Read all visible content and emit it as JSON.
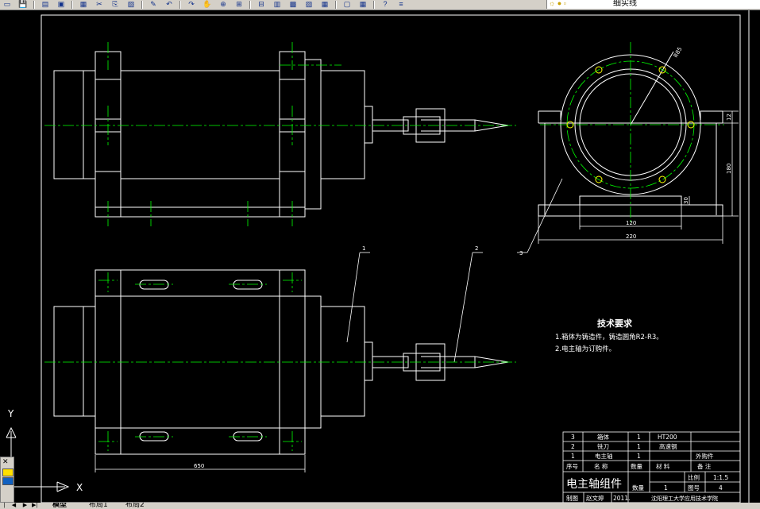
{
  "toolbar": {
    "icons": [
      "open-icon",
      "save-icon",
      "print-icon",
      "preview-icon",
      "publish-icon",
      "cut-icon",
      "copy-icon",
      "paste-icon",
      "match-properties-icon",
      "undo-icon",
      "redo-icon",
      "pan-icon",
      "zoom-realtime-icon",
      "zoom-window-icon",
      "zoom-previous-icon",
      "properties-icon",
      "design-center-icon",
      "tool-palettes-icon",
      "sheet-set-icon",
      "markup-icon",
      "calculator-icon",
      "help-icon",
      "layer-manager-icon"
    ],
    "layer_name": "细实线"
  },
  "drawing": {
    "balloons": [
      "1",
      "2",
      "3"
    ],
    "dimensions": {
      "overall_length": "650",
      "width_220": "220",
      "width_120": "120",
      "height_180": "180",
      "height_12": "12",
      "height_30": "30",
      "radius_label": "R85"
    },
    "tech_req": {
      "title": "技术要求",
      "line1": "1.箱体为铸造件，铸造圆角R2-R3。",
      "line2": "2.电主轴为订购件。"
    },
    "title_block": {
      "parts": [
        {
          "no": "3",
          "name": "箱体",
          "qty": "1",
          "material": "HT200",
          "note": ""
        },
        {
          "no": "2",
          "name": "铣刀",
          "qty": "1",
          "material": "高速钢",
          "note": ""
        },
        {
          "no": "1",
          "name": "电主轴",
          "qty": "1",
          "material": "",
          "note": "外购件"
        }
      ],
      "headers": {
        "no": "序号",
        "name": "名  称",
        "qty": "数量",
        "material": "材    料",
        "note": "备    注"
      },
      "drawing_title": "电主轴组件",
      "scale_label": "比例",
      "scale_value": "1:1.5",
      "count_label": "数量",
      "count_value": "1",
      "sheet_label": "图号",
      "sheet_value": "4",
      "drawn_label": "制图",
      "drawn_name": "赵文婷",
      "date": "2011.",
      "school": "沈阳理工大学应用技术学院"
    }
  },
  "ucs": {
    "y_label": "Y",
    "x_label": "X"
  },
  "tabs": [
    "模型",
    "布局1",
    "布局2"
  ],
  "colors": {
    "lines": "#ffffff",
    "center": "#00ff00",
    "balloon": "#ffffff",
    "bg": "#000000",
    "bolt": "#ffff00"
  }
}
